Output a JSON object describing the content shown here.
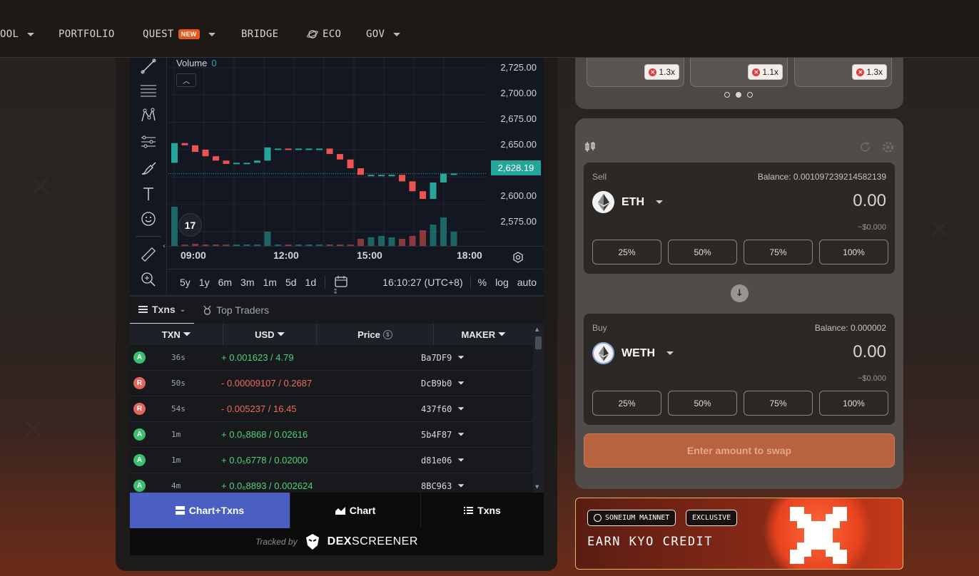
{
  "nav": {
    "items": [
      {
        "label": "OOL",
        "caret": true
      },
      {
        "label": "PORTFOLIO"
      },
      {
        "label": "QUEST",
        "badge": "NEW",
        "caret": true
      },
      {
        "label": "BRIDGE"
      },
      {
        "label": "ECO",
        "icon": "planet-icon"
      },
      {
        "label": "GOV",
        "caret": true
      }
    ]
  },
  "chart": {
    "volume_label": "Volume",
    "volume_value": "0",
    "y_ticks": [
      "2,725.00",
      "2,700.00",
      "2,675.00",
      "2,650.00",
      "2,600.00",
      "2,575.00"
    ],
    "last_price": "2,628.19",
    "x_ticks": [
      "09:00",
      "12:00",
      "15:00",
      "18:00"
    ],
    "timeframes": [
      "5y",
      "1y",
      "6m",
      "3m",
      "1m",
      "5d",
      "1d"
    ],
    "clock": "16:10:27 (UTC+8)",
    "scale_options": [
      "%",
      "log",
      "auto"
    ],
    "tv_logo": "17"
  },
  "chart_data": {
    "type": "candlestick",
    "ylim": [
      2562,
      2734
    ],
    "x_ticks": [
      "09:00",
      "12:00",
      "15:00",
      "18:00"
    ],
    "last_price": 2628.19
  },
  "txns": {
    "tabs": [
      {
        "label": "Txns"
      },
      {
        "label": "Top Traders"
      }
    ],
    "columns": [
      "TXN",
      "USD",
      "Price",
      "MAKER"
    ],
    "rows": [
      {
        "type": "A",
        "age": "36s",
        "side": "buy",
        "value": "+ 0.001623 / 4.79",
        "maker": "Ba7DF9"
      },
      {
        "type": "R",
        "age": "50s",
        "side": "sell",
        "value": "- 0.00009107 / 0.2687",
        "maker": "DcB9b0"
      },
      {
        "type": "R",
        "age": "54s",
        "side": "sell",
        "value": "- 0.005237 / 16.45",
        "maker": "437f60"
      },
      {
        "type": "A",
        "age": "1m",
        "side": "buy",
        "value": "+ 0.0₅8868 / 0.02616",
        "maker": "5b4F87"
      },
      {
        "type": "A",
        "age": "1m",
        "side": "buy",
        "value": "+ 0.0₅6778 / 0.02000",
        "maker": "d81e06"
      },
      {
        "type": "A",
        "age": "4m",
        "side": "buy",
        "value": "+ 0.0₆8893 / 0.002624",
        "maker": "8BC963"
      }
    ]
  },
  "view_tabs": [
    "Chart+Txns",
    "Chart",
    "Txns"
  ],
  "tracked": {
    "label": "Tracked by",
    "brand_a": "DEX",
    "brand_b": "SCREENER"
  },
  "carousel": {
    "multipliers": [
      "1.3x",
      "1.1x",
      "1.3x"
    ]
  },
  "swap": {
    "sell": {
      "label": "Sell",
      "balance": "Balance: 0.001097239214582139",
      "token": "ETH",
      "amount": "0.00",
      "usd": "~$0.000"
    },
    "buy": {
      "label": "Buy",
      "balance": "Balance: 0.000002",
      "token": "WETH",
      "amount": "0.00",
      "usd": "~$0.000"
    },
    "percents": [
      "25%",
      "50%",
      "75%",
      "100%"
    ],
    "button": "Enter amount to swap"
  },
  "promo": {
    "tag1": "SONEIUM MAINNET",
    "tag2": "EXCLUSIVE",
    "title": "EARN KYO CREDIT"
  },
  "colors": {
    "up": "#26a69a",
    "down": "#ef5350",
    "accent": "#e8561c",
    "active_tab": "#4a5fc1"
  }
}
